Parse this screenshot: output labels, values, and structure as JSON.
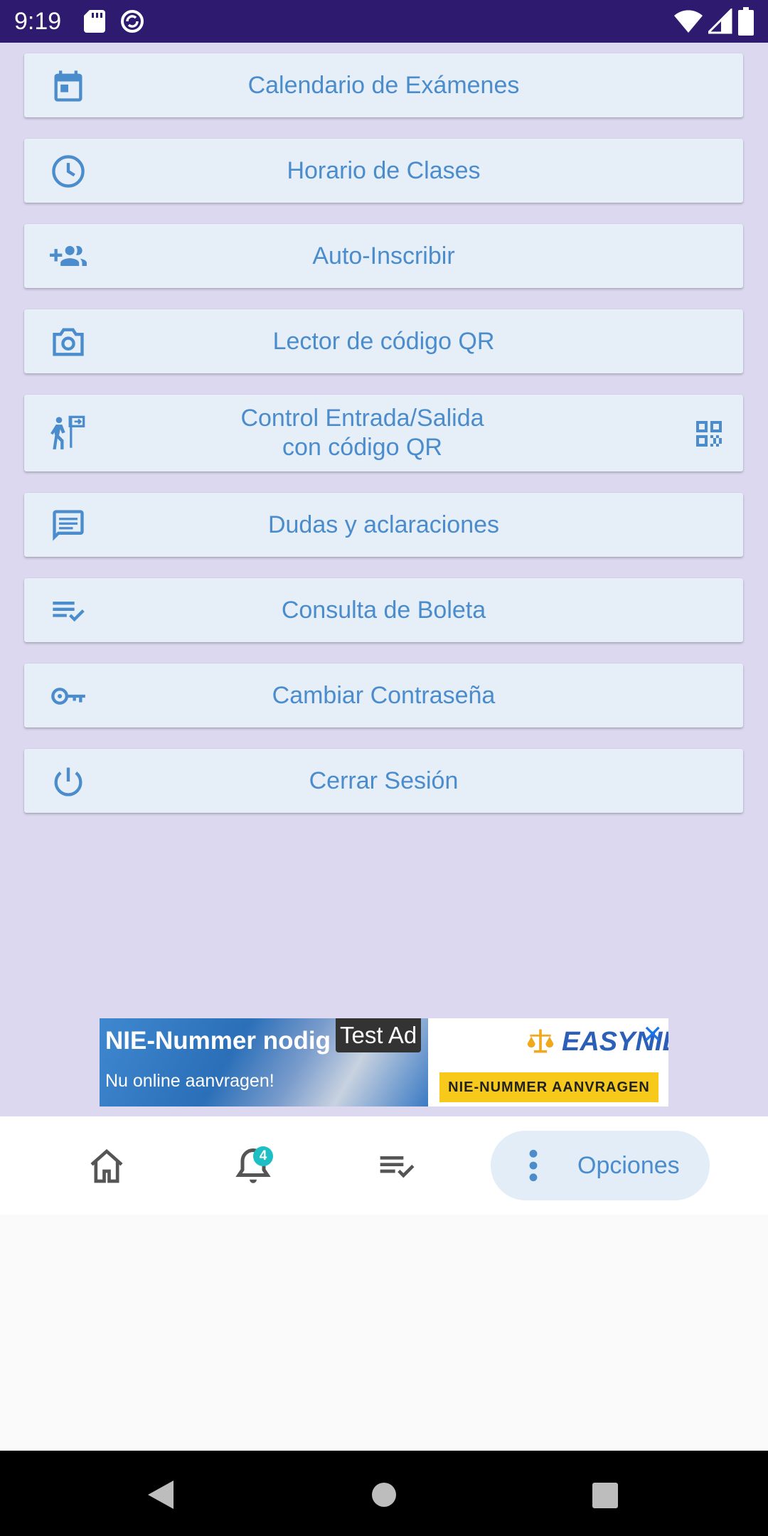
{
  "status_bar": {
    "time": "9:19",
    "icons": [
      "sd-card-icon",
      "sync-icon",
      "wifi-icon",
      "signal-icon",
      "battery-icon"
    ]
  },
  "menu": {
    "accent_color": "#4a8ccc",
    "item_background": "#e6eef8",
    "items": [
      {
        "label": "Calendario de Exámenes",
        "icon": "calendar-icon"
      },
      {
        "label": "Horario de Clases",
        "icon": "clock-icon"
      },
      {
        "label": "Auto-Inscribir",
        "icon": "add-group-icon"
      },
      {
        "label": "Lector de código QR",
        "icon": "camera-icon"
      },
      {
        "label_line1": "Control Entrada/Salida",
        "label_line2": "con código QR",
        "icon": "person-sign-icon",
        "trailing_icon": "qr-code-icon"
      },
      {
        "label": "Dudas y aclaraciones",
        "icon": "chat-icon"
      },
      {
        "label": "Consulta de Boleta",
        "icon": "list-check-icon"
      },
      {
        "label": "Cambiar Contraseña",
        "icon": "key-icon"
      },
      {
        "label": "Cerrar Sesión",
        "icon": "power-icon"
      }
    ]
  },
  "ad": {
    "headline": "NIE-Nummer nodig",
    "subline": "Nu online aanvragen!",
    "badge": "Test Ad",
    "brand": "EASYNIE",
    "cta": "NIE-NUMMER AANVRAGEN",
    "close": "✕"
  },
  "bottom_nav": {
    "notification_count": "4",
    "options_label": "Opciones",
    "icons": [
      "home-icon",
      "bell-icon",
      "list-check-icon",
      "more-vert-icon"
    ]
  },
  "system_nav": {
    "icons": [
      "back-icon",
      "home-button-icon",
      "recents-icon"
    ]
  }
}
